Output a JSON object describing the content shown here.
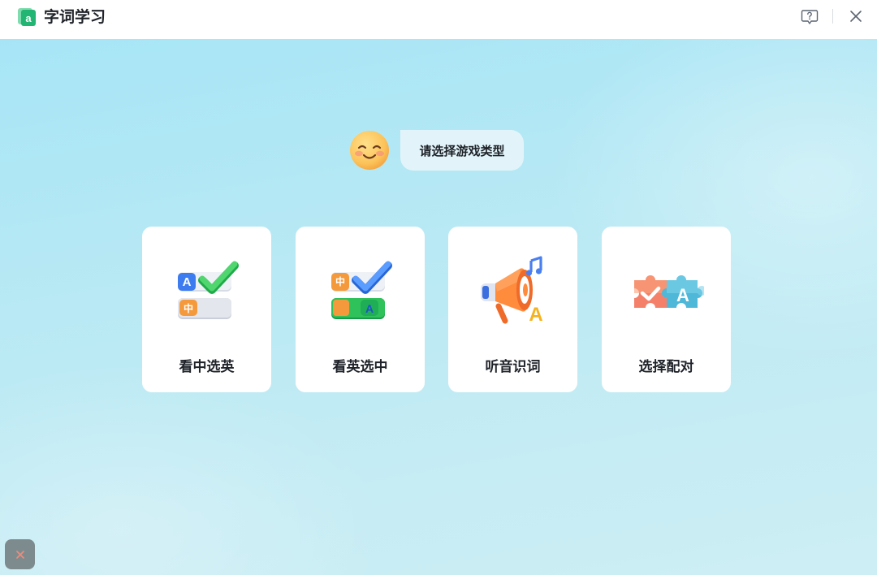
{
  "titlebar": {
    "app_title": "字词学习",
    "logo_letter": "a",
    "help_icon": "help-question-icon",
    "close_icon": "close-icon"
  },
  "prompt": {
    "avatar_icon": "smiling-face-icon",
    "text": "请选择游戏类型"
  },
  "game_types": [
    {
      "label": "看中选英",
      "icon": "chinese-to-english-check-icon"
    },
    {
      "label": "看英选中",
      "icon": "english-to-chinese-check-icon"
    },
    {
      "label": "听音识词",
      "icon": "megaphone-music-icon"
    },
    {
      "label": "选择配对",
      "icon": "puzzle-pieces-icon"
    }
  ],
  "art_text": {
    "letter_a": "A",
    "hanzi_zhong": "中"
  },
  "floating_button": {
    "icon": "close-icon"
  },
  "colors": {
    "brand_green": "#22b573",
    "background_top": "#a7e5f6",
    "background_bottom": "#cdeef4",
    "card": "#ffffff",
    "bubble": "#e2f4fa",
    "text": "#1f2329",
    "floating_button": "#7d8b8e",
    "floating_icon": "#f08a7a"
  }
}
